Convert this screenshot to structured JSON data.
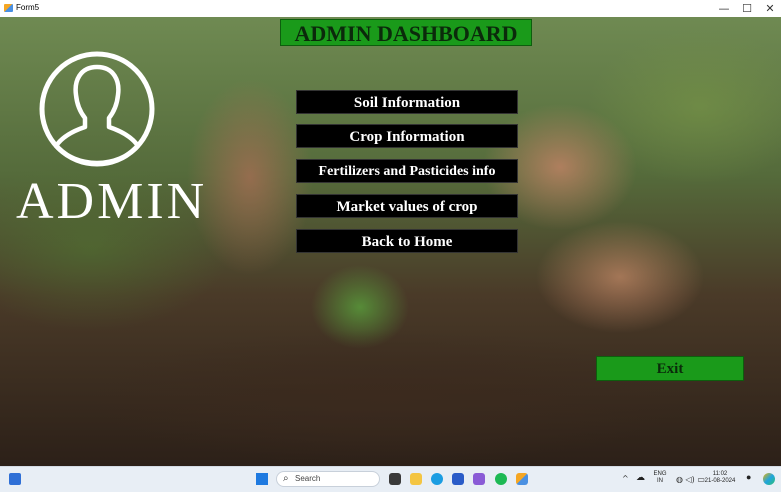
{
  "window": {
    "title": "Form5",
    "minimize_glyph": "—",
    "maximize_glyph": "☐",
    "close_glyph": "✕"
  },
  "sidebar": {
    "admin_label": "ADMIN",
    "avatar_icon": "user-silhouette-icon"
  },
  "header": {
    "title": "ADMIN DASHBOARD",
    "color": "#1a9a1a"
  },
  "menu": {
    "items": [
      {
        "label": "Soil Information"
      },
      {
        "label": "Crop Information"
      },
      {
        "label": "Fertilizers and Pasticides info"
      },
      {
        "label": "Market values of crop"
      },
      {
        "label": "Back to Home"
      }
    ]
  },
  "exit_label": "Exit",
  "taskbar": {
    "search_placeholder": "Search",
    "language": "ENG",
    "region": "IN",
    "time": "11:02",
    "date": "21-08-2024",
    "tray_icons": "◍ ◁) ▭",
    "chevron": "^"
  }
}
